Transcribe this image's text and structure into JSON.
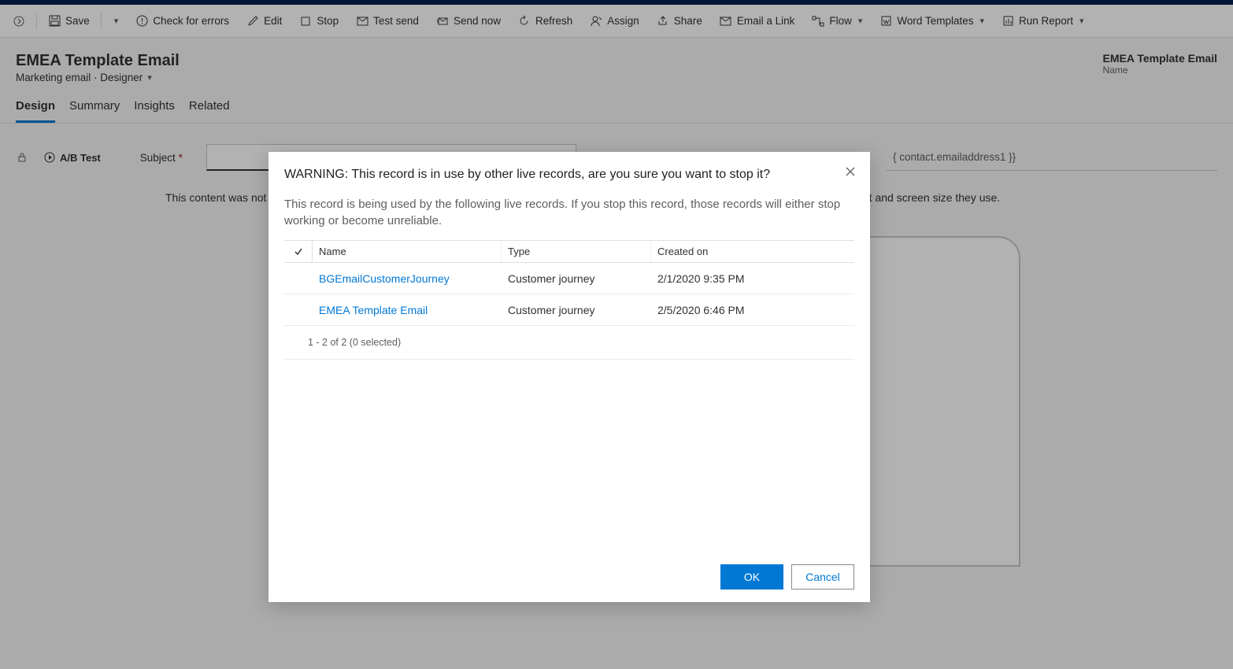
{
  "commandBar": {
    "save": "Save",
    "checkErrors": "Check for errors",
    "edit": "Edit",
    "stop": "Stop",
    "testSend": "Test send",
    "sendNow": "Send now",
    "refresh": "Refresh",
    "assign": "Assign",
    "share": "Share",
    "emailLink": "Email a Link",
    "flow": "Flow",
    "wordTemplates": "Word Templates",
    "runReport": "Run Report"
  },
  "header": {
    "title": "EMEA Template Email",
    "subtitle": "Marketing email · Designer",
    "rightValue": "EMEA Template Email",
    "rightLabel": "Name"
  },
  "tabs": {
    "design": "Design",
    "summary": "Summary",
    "insights": "Insights",
    "related": "Related"
  },
  "form": {
    "abTest": "A/B Test",
    "subjectLabel": "Subject",
    "contactToken": "{ contact.emailaddress1 }}"
  },
  "hint": "This content was not generated in this editor. Therefore some recipients might see it differently than shown here, depending on which email client and screen size they use.",
  "modal": {
    "title": "WARNING: This record is in use by other live records, are you sure you want to stop it?",
    "desc": "This record is being used by the following live records. If you stop this record, those records will either stop working or become unreliable.",
    "columns": {
      "name": "Name",
      "type": "Type",
      "created": "Created on"
    },
    "rows": [
      {
        "name": "BGEmailCustomerJourney",
        "type": "Customer journey",
        "created": "2/1/2020 9:35 PM"
      },
      {
        "name": "EMEA Template Email",
        "type": "Customer journey",
        "created": "2/5/2020 6:46 PM"
      }
    ],
    "footer": "1 - 2 of 2 (0 selected)",
    "ok": "OK",
    "cancel": "Cancel"
  }
}
